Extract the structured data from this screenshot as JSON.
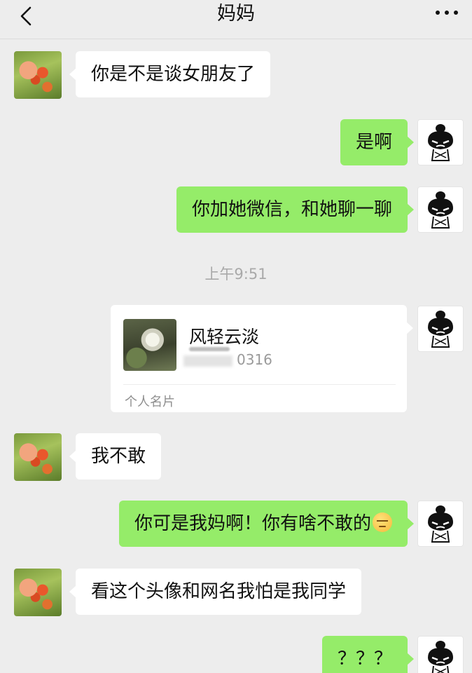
{
  "header": {
    "title": "妈妈",
    "back_icon": "chevron-left-icon",
    "more_icon": "more-icon"
  },
  "messages": [
    {
      "side": "left",
      "text": "你是不是谈女朋友了"
    },
    {
      "side": "right",
      "text": "是啊"
    },
    {
      "side": "right",
      "text": "你加她微信，和她聊一聊"
    },
    {
      "side": "left",
      "text": "我不敢"
    },
    {
      "side": "right",
      "text": "你可是我妈啊！你有啥不敢的"
    },
    {
      "side": "left",
      "text": "看这个头像和网名我怕是我同学"
    },
    {
      "side": "right",
      "text": "？？？"
    }
  ],
  "timestamp": "上午9:51",
  "contact_card": {
    "name": "风轻云淡",
    "id_suffix": "0316",
    "label": "个人名片"
  },
  "colors": {
    "background": "#ededed",
    "sent_bubble": "#95ec69",
    "received_bubble": "#ffffff"
  }
}
